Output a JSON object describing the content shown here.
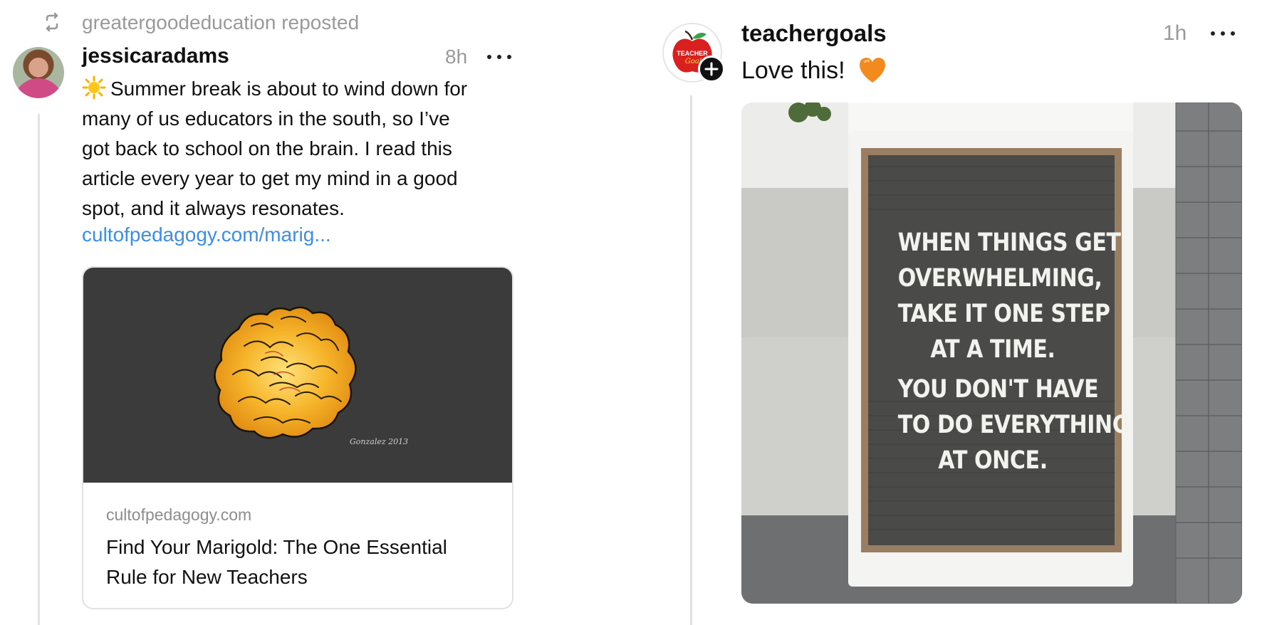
{
  "left_post": {
    "repost_label": "greatergoodeducation reposted",
    "repost_icon": "repost-icon",
    "username": "jessicaradams",
    "time": "8h",
    "more_icon": "more-horizontal-icon",
    "body_lines": [
      "Summer break is about to wind down for",
      "many of us educators in the south, so I’ve",
      "got back to school on the brain. I read this",
      "article every year to get my mind in a good",
      "spot, and it always resonates."
    ],
    "emoji_icon": "sun-icon",
    "link_text": "cultofpedagogy.com/marig...",
    "link_card": {
      "domain": "cultofpedagogy.com",
      "title": "Find Your Marigold: The One Essential Rule for New Teachers",
      "image_signature": "Gonzalez 2013"
    },
    "link_color": "#3b8ee8"
  },
  "right_post": {
    "username": "teachergoals",
    "time": "1h",
    "body": "Love this!",
    "emoji_icon": "orange-heart-icon",
    "avatar_logo_text": "TEACHER Goals",
    "follow_icon": "plus-icon",
    "sign_lines": [
      "WHEN THINGS GET",
      "OVERWHELMING,",
      "TAKE IT ONE STEP",
      "AT A TIME.",
      "YOU DON'T HAVE",
      "TO DO EVERYTHING",
      "AT ONCE."
    ]
  }
}
